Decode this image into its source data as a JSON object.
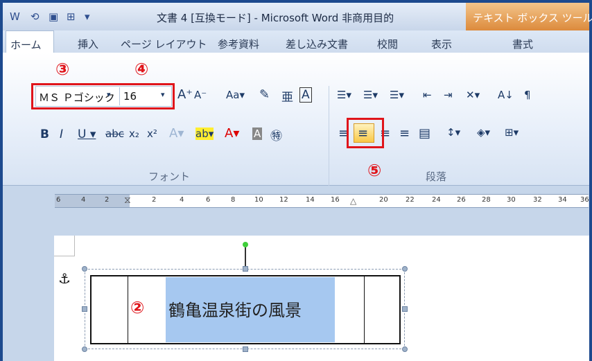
{
  "window": {
    "title": "文書 4 [互換モード] - Microsoft Word 非商用目的",
    "contextual_tab": "テキスト ボックス ツール"
  },
  "qat": [
    "⟲",
    "▣",
    "▾"
  ],
  "tabs": [
    "ホーム",
    "挿入",
    "ページ レイアウト",
    "参考資料",
    "差し込み文書",
    "校閲",
    "表示",
    "書式"
  ],
  "font": {
    "name": "ＭＳ Ｐゴシック",
    "size": "16",
    "group_label": "フォント"
  },
  "paragraph": {
    "group_label": "段落"
  },
  "annotations": {
    "n2": "②",
    "n3": "③",
    "n4": "④",
    "n5": "⑤"
  },
  "ruler": {
    "ticks": [
      "6",
      "4",
      "2",
      "2",
      "4",
      "6",
      "8",
      "10",
      "12",
      "14",
      "16",
      "20",
      "22",
      "24",
      "26",
      "28",
      "30",
      "32",
      "34",
      "36"
    ]
  },
  "document": {
    "heading": "鶴亀温泉街の風景"
  },
  "colors": {
    "highlight": "#e0151b",
    "selection": "#a6c8f0"
  }
}
